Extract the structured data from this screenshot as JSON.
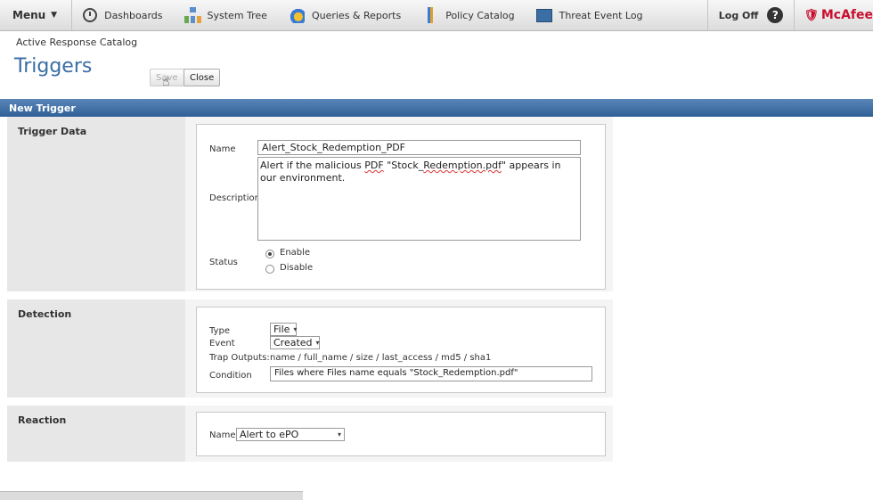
{
  "nav": {
    "menu_label": "Menu",
    "items": [
      {
        "label": "Dashboards",
        "icon": "clock-icon"
      },
      {
        "label": "System Tree",
        "icon": "system-tree-icon"
      },
      {
        "label": "Queries & Reports",
        "icon": "queries-reports-icon"
      },
      {
        "label": "Policy Catalog",
        "icon": "policy-catalog-icon"
      },
      {
        "label": "Threat Event Log",
        "icon": "threat-event-log-icon"
      }
    ],
    "logoff_label": "Log Off",
    "help_label": "?",
    "brand": "McAfee"
  },
  "header": {
    "breadcrumb": "Active Response Catalog",
    "title": "Triggers",
    "save_label": "Save",
    "close_label": "Close"
  },
  "section_title": "New Trigger",
  "trigger_data": {
    "section_label": "Trigger Data",
    "name_label": "Name",
    "name_value": "Alert_Stock_Redemption_PDF",
    "description_label": "Description",
    "description_pre": "Alert if the malicious ",
    "description_pdf": "PDF",
    "description_mid": " \"Stock_",
    "description_file": "Redemption.pdf",
    "description_post": "\" appears in our environment.",
    "status_label": "Status",
    "status_options": [
      "Enable",
      "Disable"
    ],
    "status_selected": "Enable"
  },
  "detection": {
    "section_label": "Detection",
    "type_label": "Type",
    "type_value": "File",
    "event_label": "Event",
    "event_value": "Created",
    "trap_outputs_label": "Trap Outputs:",
    "trap_outputs_value": "name / full_name / size / last_access / md5 / sha1",
    "condition_label": "Condition",
    "condition_value": "Files where Files name equals \"Stock_Redemption.pdf\""
  },
  "reaction": {
    "section_label": "Reaction",
    "name_label": "Name",
    "name_value": "Alert to ePO"
  },
  "colors": {
    "section_bar": "#3b6aa0",
    "title": "#3a6ea5",
    "brand": "#c8102e"
  }
}
